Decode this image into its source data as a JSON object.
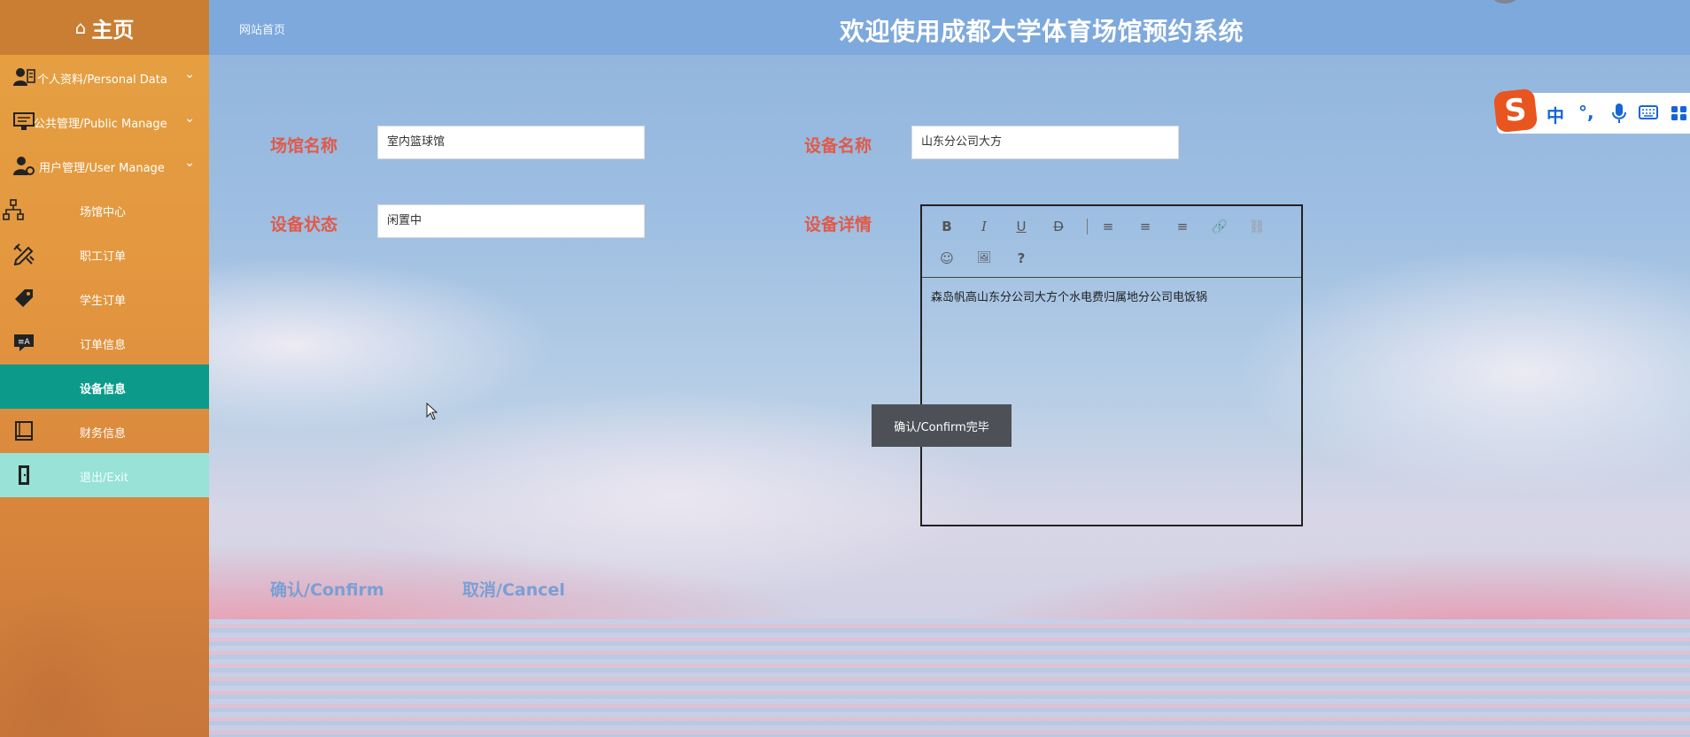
{
  "header": {
    "nav_link": "网站首页",
    "title": "欢迎使用成都大学体育场馆预约系统"
  },
  "sidebar": {
    "home_label": "主页",
    "items": [
      {
        "label": "个人资料/Personal Data",
        "icon": "user-card-icon"
      },
      {
        "label": "公共管理/Public Manage",
        "icon": "monitor-icon"
      },
      {
        "label": "用户管理/User Manage",
        "icon": "user-gear-icon"
      },
      {
        "label": "场馆中心",
        "icon": "sitemap-icon"
      },
      {
        "label": "职工订单",
        "icon": "pencil-ruler-icon"
      },
      {
        "label": "学生订单",
        "icon": "tag-icon"
      },
      {
        "label": "订单信息",
        "icon": "translate-icon"
      },
      {
        "label": "设备信息",
        "icon": ""
      },
      {
        "label": "财务信息",
        "icon": "book-icon"
      },
      {
        "label": "退出/Exit",
        "icon": "door-icon"
      }
    ]
  },
  "form": {
    "venue_name_label": "场馆名称",
    "venue_name_value": "室内篮球馆",
    "equipment_name_label": "设备名称",
    "equipment_name_value": "山东分公司大方",
    "equipment_status_label": "设备状态",
    "equipment_status_value": "闲置中",
    "equipment_detail_label": "设备详情",
    "editor_content": "森岛帆高山东分公司大方个水电费归属地分公司电饭锅",
    "editor_toolbar": [
      "B",
      "I",
      "U",
      "D",
      "≡",
      "≡",
      "≡",
      "🔗",
      "⛓",
      "☺",
      "🖼",
      "?"
    ]
  },
  "toast": {
    "message": "确认/Confirm完毕"
  },
  "actions": {
    "confirm_label": "确认/Confirm",
    "cancel_label": "取消/Cancel"
  },
  "ime": {
    "lang_label": "中",
    "punct_label": "°,"
  },
  "colors": {
    "topbar": "#7ea9dc",
    "sidebar": "#e3963f",
    "active_item": "#0c9b8a",
    "exit_item": "#98e2d7",
    "form_label": "#e05a4a",
    "action_text": "#7a9fd4"
  }
}
